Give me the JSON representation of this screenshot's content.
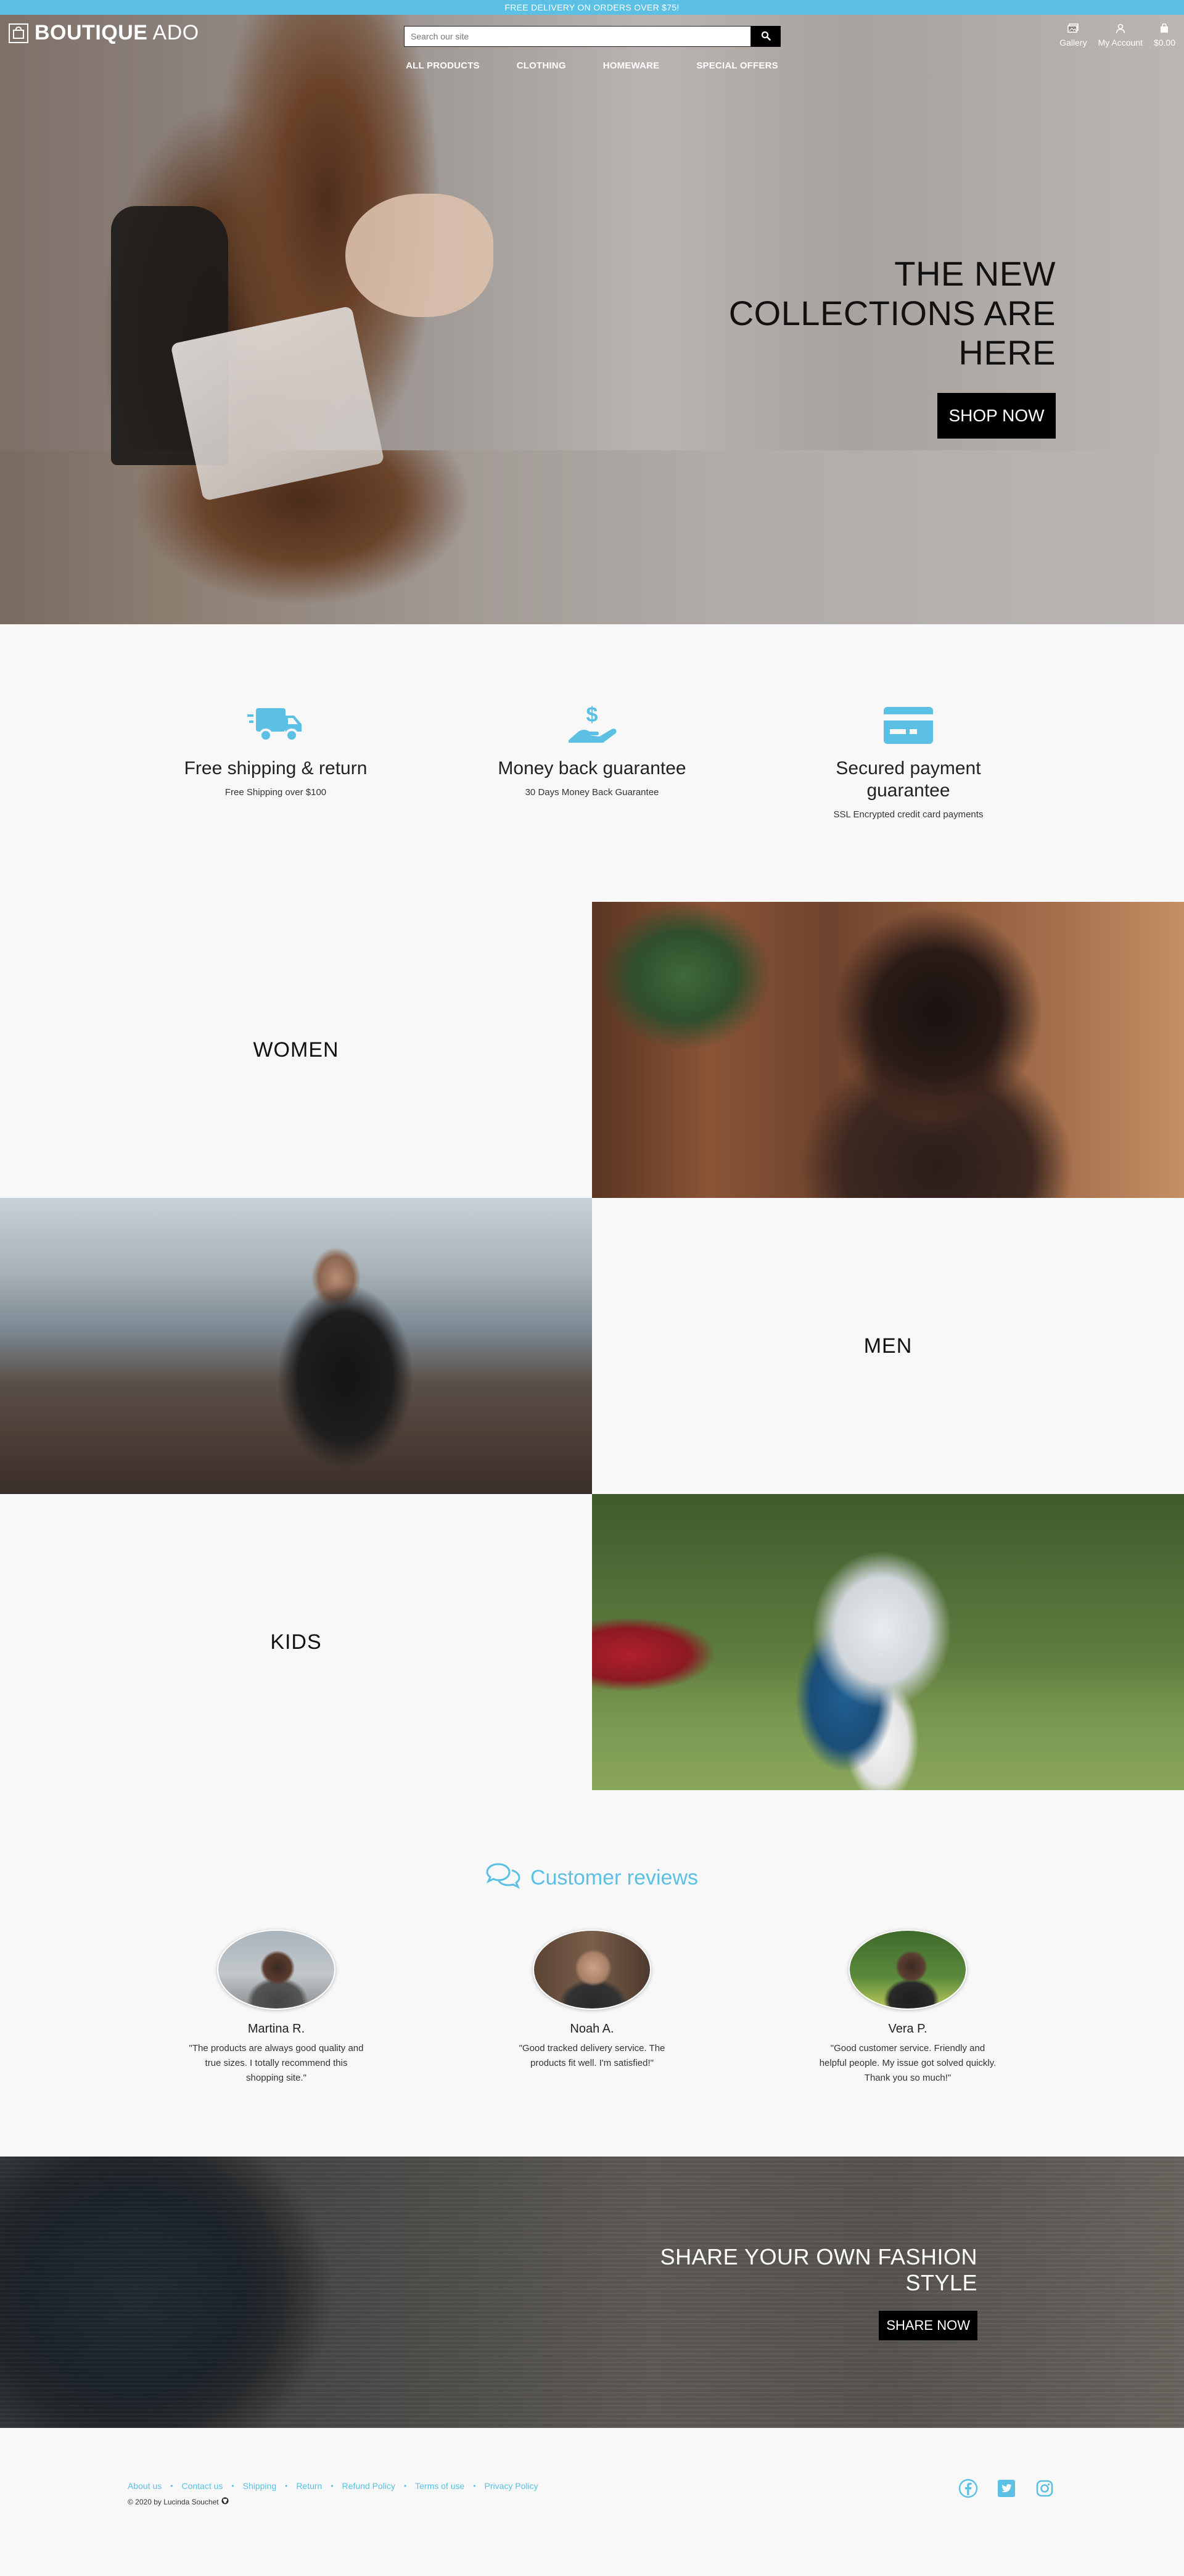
{
  "promo": {
    "text": "FREE DELIVERY ON ORDERS OVER $75!"
  },
  "header": {
    "logo_bold": "BOUTIQUE",
    "logo_light": " ADO",
    "search_placeholder": "Search our site",
    "nav": [
      "ALL PRODUCTS",
      "CLOTHING",
      "HOMEWARE",
      "SPECIAL OFFERS"
    ],
    "account": [
      {
        "label": "Gallery",
        "icon": "gallery-icon"
      },
      {
        "label": "My Account",
        "icon": "user-icon"
      },
      {
        "label": "$0.00",
        "icon": "shopping-bag-icon"
      }
    ]
  },
  "hero": {
    "line1": "THE NEW",
    "line2": "COLLECTIONS ARE",
    "line3": "HERE",
    "cta": "SHOP NOW"
  },
  "features": [
    {
      "icon": "delivery-truck-icon",
      "title": "Free shipping & return",
      "subtitle": "Free Shipping over $100"
    },
    {
      "icon": "money-hand-icon",
      "title": "Money back guarantee",
      "subtitle": "30 Days Money Back Guarantee"
    },
    {
      "icon": "credit-card-icon",
      "title": "Secured payment guarantee",
      "subtitle": "SSL Encrypted credit card payments"
    }
  ],
  "categories": {
    "women": "WOMEN",
    "men": "MEN",
    "kids": "KIDS"
  },
  "reviews": {
    "title": "Customer reviews",
    "items": [
      {
        "name": "Martina R.",
        "text": "\"The products are always good quality and true sizes. I totally recommend this shopping site.\""
      },
      {
        "name": "Noah A.",
        "text": "\"Good tracked delivery service. The products fit well. I'm satisfied!\""
      },
      {
        "name": "Vera P.",
        "text": "\"Good customer service. Friendly and helpful people. My issue got solved quickly. Thank you so much!\""
      }
    ]
  },
  "share": {
    "line1": "SHARE YOUR OWN FASHION",
    "line2": "STYLE",
    "cta": "SHARE NOW"
  },
  "footer": {
    "links": [
      "About us",
      "Contact us",
      "Shipping",
      "Return",
      "Refund Policy",
      "Terms of use",
      "Privacy Policy"
    ],
    "copyright": "© 2020 by Lucinda Souchet",
    "social": [
      "facebook-icon",
      "twitter-icon",
      "instagram-icon"
    ]
  },
  "colors": {
    "accent": "#5bc0e3",
    "button": "#000000",
    "background": "#f8f8f8"
  }
}
